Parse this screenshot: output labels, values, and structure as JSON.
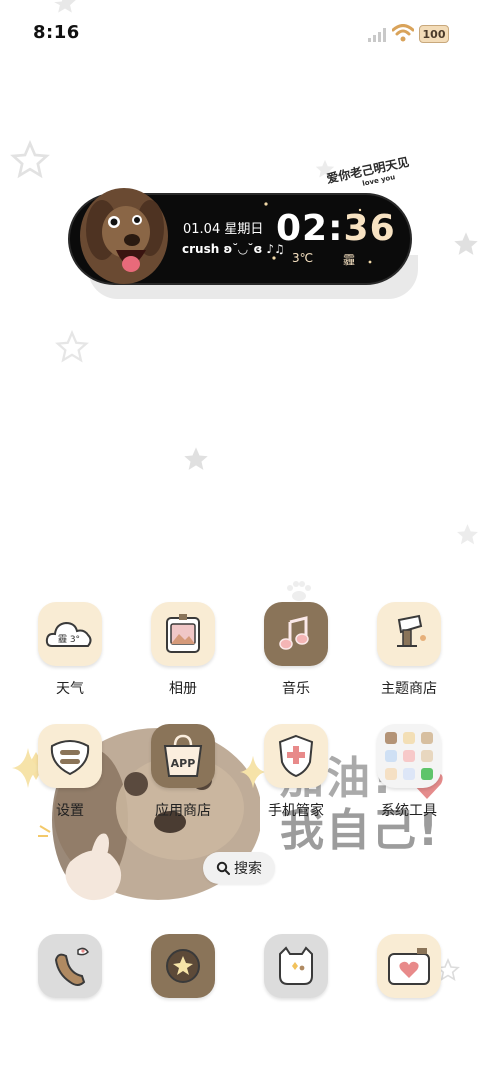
{
  "status_bar": {
    "time": "8:16",
    "battery": "100"
  },
  "clock_widget": {
    "date": "01.04 星期日",
    "crush_text": "crush ʚ˘◡˘ɞ ♪♫",
    "hour": "02",
    "separator": ":",
    "minute": "36",
    "temperature": "3℃",
    "weather": "霾",
    "sticker_main": "爱你老己明天见",
    "sticker_sub": "love you"
  },
  "apps": [
    {
      "label": "天气",
      "icon": "weather-icon",
      "badge": "霾 3°"
    },
    {
      "label": "相册",
      "icon": "gallery-icon"
    },
    {
      "label": "音乐",
      "icon": "music-icon"
    },
    {
      "label": "主题商店",
      "icon": "theme-store-icon"
    },
    {
      "label": "设置",
      "icon": "settings-icon"
    },
    {
      "label": "应用商店",
      "icon": "app-store-icon",
      "badge": "APP"
    },
    {
      "label": "手机管家",
      "icon": "phone-manager-icon"
    },
    {
      "label": "系统工具",
      "icon": "system-tools-folder-icon"
    }
  ],
  "wallpaper": {
    "slogan_line1": "加油!",
    "slogan_line2": "我自己!"
  },
  "search": {
    "label": "搜索"
  },
  "dock": [
    {
      "icon": "phone-icon"
    },
    {
      "icon": "browser-icon"
    },
    {
      "icon": "messages-icon"
    },
    {
      "icon": "camera-icon"
    }
  ],
  "colors": {
    "cream": "#f9ecd4",
    "brown": "#8a7459",
    "grey": "#dcdcdc",
    "widget_bg": "#0b0b0b"
  }
}
